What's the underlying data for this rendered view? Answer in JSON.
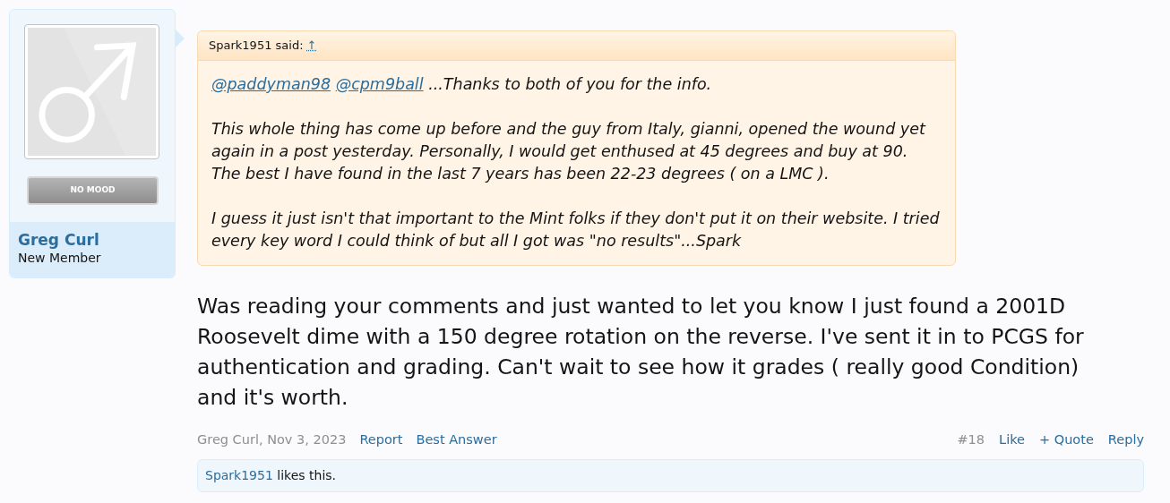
{
  "author": {
    "name": "Greg Curl",
    "title": "New Member",
    "mood": "NO MOOD"
  },
  "quote": {
    "author": "Spark1951 said:",
    "jump": "↑",
    "mentions": [
      "@paddyman98",
      "@cpm9ball"
    ],
    "paragraphs": [
      "...Thanks to both of you for the info.",
      "This whole thing has come up before and the guy from Italy, gianni, opened the wound yet again in a post yesterday. Personally, I would get enthused at 45 degrees and buy at 90. The best I have found in the last 7 years has been 22-23 degrees ( on a LMC ).",
      "I guess it just isn't that important to the Mint folks if they don't put it on their website. I tried every key word I could think of but all I got was \"no results\"...Spark"
    ]
  },
  "message": "Was reading your comments and just wanted to let you know I just found a 2001D Roosevelt dime with a 150 degree rotation on the reverse. I've sent it in to PCGS for authentication and grading. Can't wait to see how it grades ( really good Condition) and it's worth.",
  "meta": {
    "byline": "Greg Curl, Nov 3, 2023",
    "left_links": [
      "Report",
      "Best Answer"
    ],
    "number": "#18",
    "right_links": [
      "Like",
      "+ Quote",
      "Reply"
    ]
  },
  "likes": {
    "user": "Spark1951",
    "text": "likes this."
  }
}
